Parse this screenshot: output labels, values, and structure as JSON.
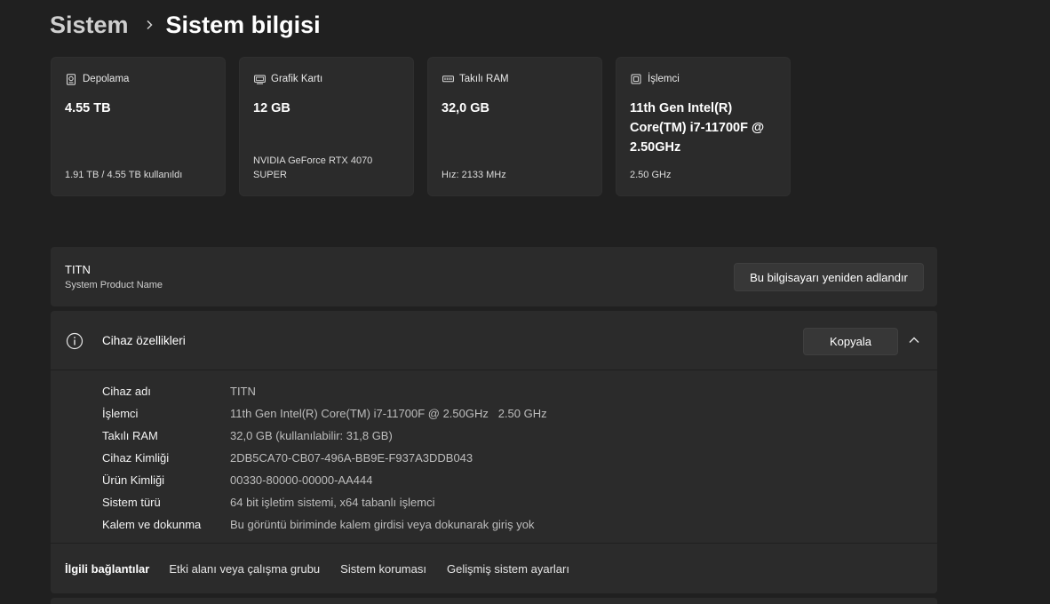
{
  "breadcrumb": {
    "parent": "Sistem",
    "current": "Sistem bilgisi"
  },
  "cards": [
    {
      "icon": "storage-icon",
      "label": "Depolama",
      "value": "4.55 TB",
      "sub": "1.91 TB / 4.55 TB kullanıldı"
    },
    {
      "icon": "gpu-icon",
      "label": "Grafik Kartı",
      "value": "12 GB",
      "sub": "NVIDIA GeForce RTX 4070 SUPER"
    },
    {
      "icon": "ram-icon",
      "label": "Takılı RAM",
      "value": "32,0 GB",
      "sub": "Hız: 2133 MHz"
    },
    {
      "icon": "cpu-icon",
      "label": "İşlemci",
      "value": "11th Gen Intel(R) Core(TM) i7-11700F @ 2.50GHz",
      "sub": "2.50 GHz"
    }
  ],
  "product": {
    "name": "TITN",
    "sub": "System Product Name",
    "rename_label": "Bu bilgisayarı yeniden adlandır"
  },
  "device": {
    "title": "Cihaz özellikleri",
    "copy_label": "Kopyala",
    "specs": [
      {
        "key": "Cihaz adı",
        "value": "TITN"
      },
      {
        "key": "İşlemci",
        "value": "11th Gen Intel(R) Core(TM) i7-11700F @ 2.50GHz   2.50 GHz"
      },
      {
        "key": "Takılı RAM",
        "value": "32,0 GB (kullanılabilir: 31,8 GB)"
      },
      {
        "key": "Cihaz Kimliği",
        "value": "2DB5CA70-CB07-496A-BB9E-F937A3DDB043"
      },
      {
        "key": "Ürün Kimliği",
        "value": "00330-80000-00000-AA444"
      },
      {
        "key": "Sistem türü",
        "value": "64 bit işletim sistemi, x64 tabanlı işlemci"
      },
      {
        "key": "Kalem ve dokunma",
        "value": "Bu görüntü biriminde kalem girdisi veya dokunarak giriş yok"
      }
    ]
  },
  "related": {
    "title": "İlgili bağlantılar",
    "links": [
      "Etki alanı veya çalışma grubu",
      "Sistem koruması",
      "Gelişmiş sistem ayarları"
    ]
  }
}
